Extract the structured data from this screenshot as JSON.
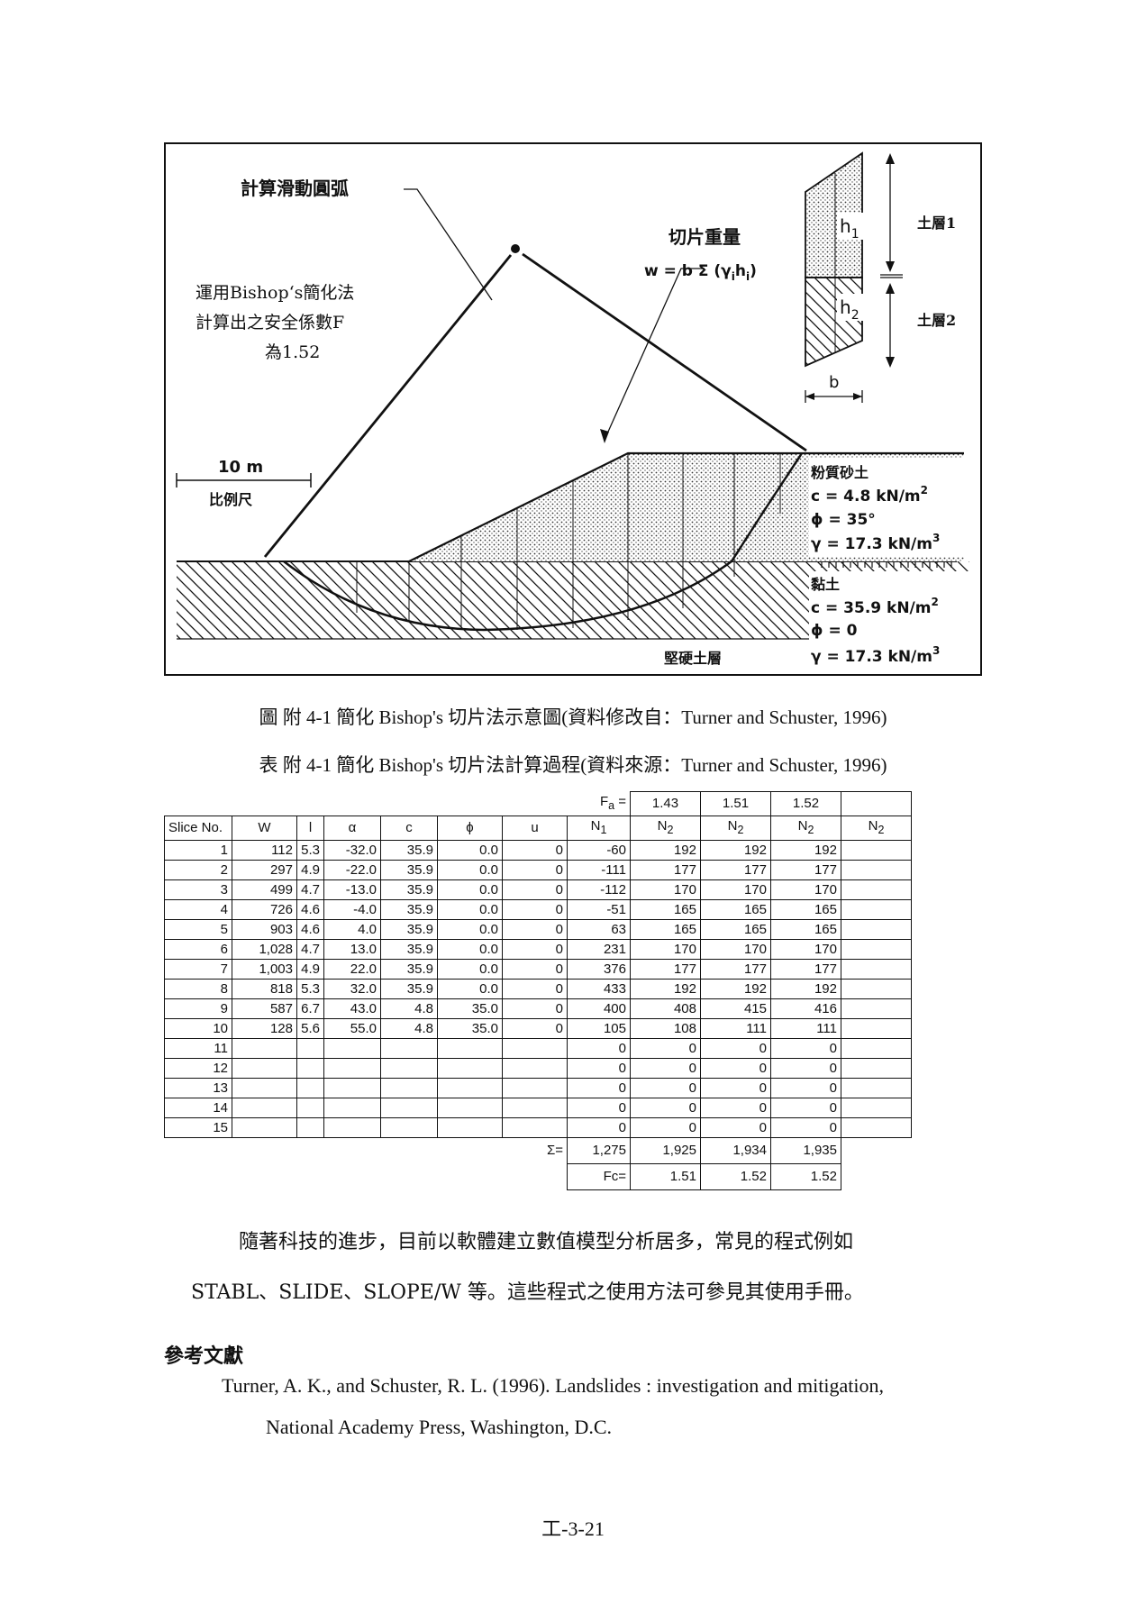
{
  "figure": {
    "label_arc": "計算滑動圓弧",
    "label_bishop_lines": [
      "運用Bishop‘s簡化法",
      "計算出之安全係數F",
      "為1.52"
    ],
    "label_slice_weight": "切片重量",
    "formula_base": "w = b Σ (γ",
    "formula_i": "i",
    "formula_h": "h",
    "formula_i2": "i",
    "formula_close": ")",
    "h1": "h",
    "h1_sub": "1",
    "h2": "h",
    "h2_sub": "2",
    "b_label": "b",
    "layer1": "土層1",
    "layer2": "土層2",
    "scale_value": "10 m",
    "scale_label": "比例尺",
    "soil1_name": "粉質砂土",
    "soil1_c": "c = 4.8 kN/m",
    "soil1_c_exp": "2",
    "soil1_phi": "ϕ = 35°",
    "soil1_gamma": "γ = 17.3 kN/m",
    "soil1_gamma_exp": "3",
    "soil2_name": "黏土",
    "soil2_c": "c = 35.9 kN/m",
    "soil2_c_exp": "2",
    "soil2_phi": "ϕ = 0",
    "soil2_gamma": "γ = 17.3 kN/m",
    "soil2_gamma_exp": "3",
    "hard_layer": "堅硬土層"
  },
  "figure_caption": "圖 附 4-1 簡化 Bishop's 切片法示意圖(資料修改自：Turner and Schuster, 1996)",
  "table_caption": "表 附 4-1 簡化 Bishop's 切片法計算過程(資料來源：Turner and Schuster, 1996)",
  "table": {
    "fa_label": "F",
    "fa_sub": "a",
    "fa_eq": " =",
    "fa_values": [
      "1.43",
      "1.51",
      "1.52",
      ""
    ],
    "headers": [
      "Slice No.",
      "W",
      "l",
      "α",
      "c",
      "ϕ",
      "u"
    ],
    "n1_base": "N",
    "n1_sub": "1",
    "n2_base": "N",
    "n2_sub": "2",
    "rows": [
      [
        "1",
        "112",
        "5.3",
        "-32.0",
        "35.9",
        "0.0",
        "0",
        "-60",
        "192",
        "192",
        "192",
        ""
      ],
      [
        "2",
        "297",
        "4.9",
        "-22.0",
        "35.9",
        "0.0",
        "0",
        "-111",
        "177",
        "177",
        "177",
        ""
      ],
      [
        "3",
        "499",
        "4.7",
        "-13.0",
        "35.9",
        "0.0",
        "0",
        "-112",
        "170",
        "170",
        "170",
        ""
      ],
      [
        "4",
        "726",
        "4.6",
        "-4.0",
        "35.9",
        "0.0",
        "0",
        "-51",
        "165",
        "165",
        "165",
        ""
      ],
      [
        "5",
        "903",
        "4.6",
        "4.0",
        "35.9",
        "0.0",
        "0",
        "63",
        "165",
        "165",
        "165",
        ""
      ],
      [
        "6",
        "1,028",
        "4.7",
        "13.0",
        "35.9",
        "0.0",
        "0",
        "231",
        "170",
        "170",
        "170",
        ""
      ],
      [
        "7",
        "1,003",
        "4.9",
        "22.0",
        "35.9",
        "0.0",
        "0",
        "376",
        "177",
        "177",
        "177",
        ""
      ],
      [
        "8",
        "818",
        "5.3",
        "32.0",
        "35.9",
        "0.0",
        "0",
        "433",
        "192",
        "192",
        "192",
        ""
      ],
      [
        "9",
        "587",
        "6.7",
        "43.0",
        "4.8",
        "35.0",
        "0",
        "400",
        "408",
        "415",
        "416",
        ""
      ],
      [
        "10",
        "128",
        "5.6",
        "55.0",
        "4.8",
        "35.0",
        "0",
        "105",
        "108",
        "111",
        "111",
        ""
      ],
      [
        "11",
        "",
        "",
        "",
        "",
        "",
        "",
        "0",
        "0",
        "0",
        "0",
        ""
      ],
      [
        "12",
        "",
        "",
        "",
        "",
        "",
        "",
        "0",
        "0",
        "0",
        "0",
        ""
      ],
      [
        "13",
        "",
        "",
        "",
        "",
        "",
        "",
        "0",
        "0",
        "0",
        "0",
        ""
      ],
      [
        "14",
        "",
        "",
        "",
        "",
        "",
        "",
        "0",
        "0",
        "0",
        "0",
        ""
      ],
      [
        "15",
        "",
        "",
        "",
        "",
        "",
        "",
        "0",
        "0",
        "0",
        "0",
        ""
      ]
    ],
    "sum_label": "Σ=",
    "sum_values": [
      "1,275",
      "1,925",
      "1,934",
      "1,935"
    ],
    "fc_label": "Fc=",
    "fc_values": [
      "1.51",
      "1.52",
      "1.52"
    ]
  },
  "paragraph_line1": "隨著科技的進步，目前以軟體建立數值模型分析居多，常見的程式例如",
  "paragraph_line2": "STABL、SLIDE、SLOPE/W 等。這些程式之使用方法可參見其使用手冊。",
  "references_heading": "參考文獻",
  "reference_line1": "Turner, A. K., and Schuster, R. L. (1996). Landslides : investigation and mitigation,",
  "reference_line2": "National Academy Press, Washington, D.C.",
  "page_number": "工-3-21"
}
